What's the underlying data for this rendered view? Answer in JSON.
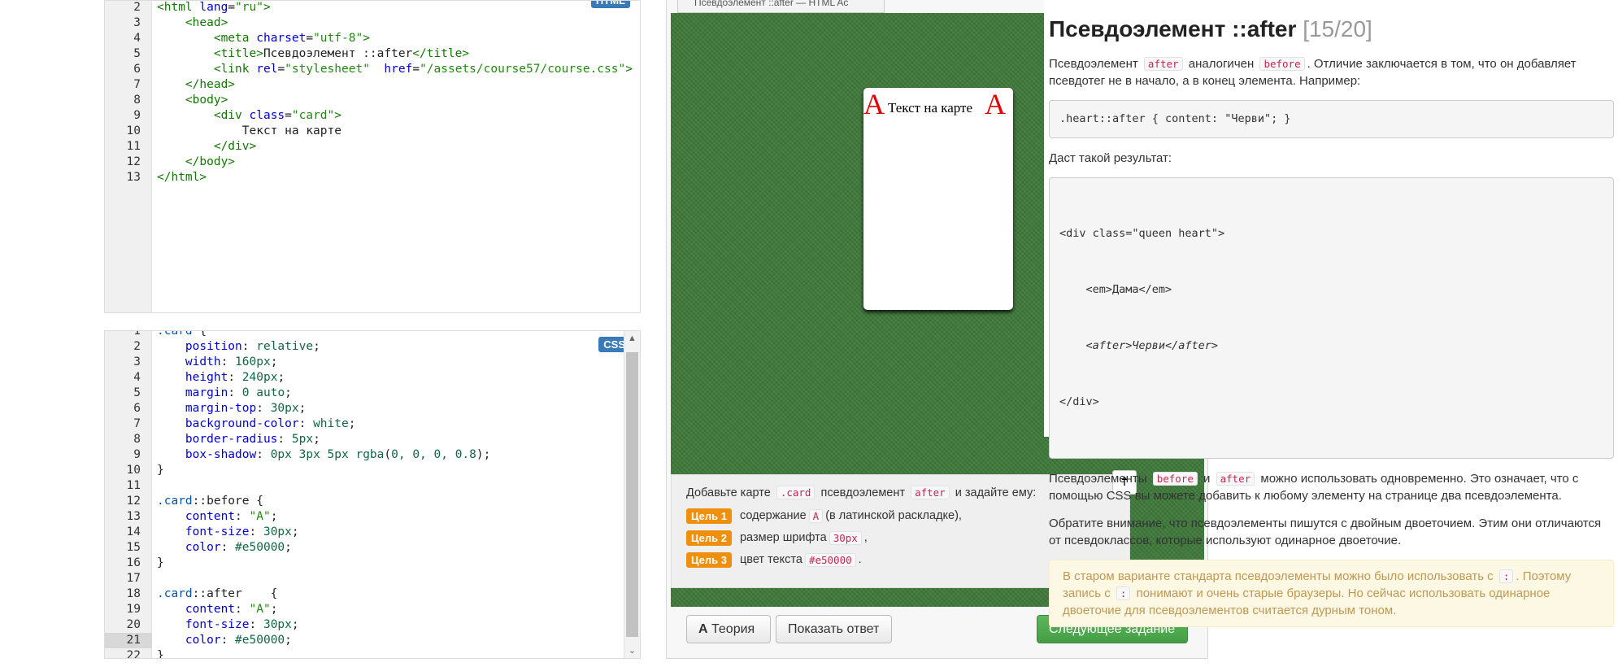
{
  "html_editor": {
    "badge": "HTML",
    "lines": [
      {
        "n": "2",
        "parts": [
          [
            "t-tag",
            "<html "
          ],
          [
            "t-attr",
            "lang"
          ],
          [
            "",
            "="
          ],
          [
            "t-str2",
            "\"ru\""
          ],
          [
            "t-tag",
            ">"
          ]
        ]
      },
      {
        "n": "3",
        "parts": [
          [
            "",
            "    "
          ],
          [
            "t-tag",
            "<head>"
          ]
        ]
      },
      {
        "n": "4",
        "parts": [
          [
            "",
            "        "
          ],
          [
            "t-tag",
            "<meta "
          ],
          [
            "t-attr",
            "charset"
          ],
          [
            "",
            "="
          ],
          [
            "t-str2",
            "\"utf-8\""
          ],
          [
            "t-tag",
            ">"
          ]
        ]
      },
      {
        "n": "5",
        "parts": [
          [
            "",
            "        "
          ],
          [
            "t-tag",
            "<title>"
          ],
          [
            "",
            "Псевдоэлемент ::after"
          ],
          [
            "t-tag",
            "</title>"
          ]
        ]
      },
      {
        "n": "6",
        "parts": [
          [
            "",
            "        "
          ],
          [
            "t-tag",
            "<link "
          ],
          [
            "t-attr",
            "rel"
          ],
          [
            "",
            "="
          ],
          [
            "t-str2",
            "\"stylesheet\""
          ],
          [
            "",
            "  "
          ],
          [
            "t-attr",
            "href"
          ],
          [
            "",
            "="
          ],
          [
            "t-str2",
            "\"/assets/course57/course.css\""
          ],
          [
            "t-tag",
            ">"
          ]
        ]
      },
      {
        "n": "7",
        "parts": [
          [
            "",
            "    "
          ],
          [
            "t-tag",
            "</head>"
          ]
        ]
      },
      {
        "n": "8",
        "parts": [
          [
            "",
            "    "
          ],
          [
            "t-tag",
            "<body>"
          ]
        ]
      },
      {
        "n": "9",
        "parts": [
          [
            "",
            "        "
          ],
          [
            "t-tag",
            "<div "
          ],
          [
            "t-attr",
            "class"
          ],
          [
            "",
            "="
          ],
          [
            "t-str2",
            "\"card\""
          ],
          [
            "t-tag",
            ">"
          ]
        ]
      },
      {
        "n": "10",
        "parts": [
          [
            "",
            "            Текст на карте"
          ]
        ]
      },
      {
        "n": "11",
        "parts": [
          [
            "",
            "        "
          ],
          [
            "t-tag",
            "</div>"
          ]
        ]
      },
      {
        "n": "12",
        "parts": [
          [
            "",
            "    "
          ],
          [
            "t-tag",
            "</body>"
          ]
        ]
      },
      {
        "n": "13",
        "parts": [
          [
            "t-tag",
            "</html>"
          ]
        ]
      }
    ]
  },
  "css_editor": {
    "badge": "CSS",
    "lines": [
      {
        "n": "1",
        "parts": [
          [
            "t-sel",
            ".card "
          ],
          [
            "",
            "{"
          ]
        ]
      },
      {
        "n": "2",
        "parts": [
          [
            "",
            "    "
          ],
          [
            "t-prop",
            "position"
          ],
          [
            "",
            ": "
          ],
          [
            "t-val",
            "relative"
          ],
          [
            "",
            ";"
          ]
        ]
      },
      {
        "n": "3",
        "parts": [
          [
            "",
            "    "
          ],
          [
            "t-prop",
            "width"
          ],
          [
            "",
            ": "
          ],
          [
            "t-num",
            "160px"
          ],
          [
            "",
            ";"
          ]
        ]
      },
      {
        "n": "4",
        "parts": [
          [
            "",
            "    "
          ],
          [
            "t-prop",
            "height"
          ],
          [
            "",
            ": "
          ],
          [
            "t-num",
            "240px"
          ],
          [
            "",
            ";"
          ]
        ]
      },
      {
        "n": "5",
        "parts": [
          [
            "",
            "    "
          ],
          [
            "t-prop",
            "margin"
          ],
          [
            "",
            ": "
          ],
          [
            "t-num",
            "0"
          ],
          [
            "",
            " "
          ],
          [
            "t-val",
            "auto"
          ],
          [
            "",
            ";"
          ]
        ]
      },
      {
        "n": "6",
        "parts": [
          [
            "",
            "    "
          ],
          [
            "t-prop",
            "margin-top"
          ],
          [
            "",
            ": "
          ],
          [
            "t-num",
            "30px"
          ],
          [
            "",
            ";"
          ]
        ]
      },
      {
        "n": "7",
        "parts": [
          [
            "",
            "    "
          ],
          [
            "t-prop",
            "background-color"
          ],
          [
            "",
            ": "
          ],
          [
            "t-val",
            "white"
          ],
          [
            "",
            ";"
          ]
        ]
      },
      {
        "n": "8",
        "parts": [
          [
            "",
            "    "
          ],
          [
            "t-prop",
            "border-radius"
          ],
          [
            "",
            ": "
          ],
          [
            "t-num",
            "5px"
          ],
          [
            "",
            ";"
          ]
        ]
      },
      {
        "n": "9",
        "parts": [
          [
            "",
            "    "
          ],
          [
            "t-prop",
            "box-shadow"
          ],
          [
            "",
            ": "
          ],
          [
            "t-num",
            "0px 3px 5px "
          ],
          [
            "t-val",
            "rgba"
          ],
          [
            "",
            "("
          ],
          [
            "t-num",
            "0, 0, 0, 0.8"
          ],
          [
            "",
            ");"
          ]
        ]
      },
      {
        "n": "10",
        "parts": [
          [
            "",
            "}"
          ]
        ]
      },
      {
        "n": "11",
        "parts": []
      },
      {
        "n": "12",
        "parts": [
          [
            "t-sel",
            ".card"
          ],
          [
            "",
            "::before {"
          ]
        ]
      },
      {
        "n": "13",
        "parts": [
          [
            "",
            "    "
          ],
          [
            "t-prop",
            "content"
          ],
          [
            "",
            ": "
          ],
          [
            "t-str2",
            "\"A\""
          ],
          [
            "",
            ";"
          ]
        ]
      },
      {
        "n": "14",
        "parts": [
          [
            "",
            "    "
          ],
          [
            "t-prop",
            "font-size"
          ],
          [
            "",
            ": "
          ],
          [
            "t-num",
            "30px"
          ],
          [
            "",
            ";"
          ]
        ]
      },
      {
        "n": "15",
        "parts": [
          [
            "",
            "    "
          ],
          [
            "t-prop",
            "color"
          ],
          [
            "",
            ": "
          ],
          [
            "t-num",
            "#e50000"
          ],
          [
            "",
            ";"
          ]
        ]
      },
      {
        "n": "16",
        "parts": [
          [
            "",
            "}"
          ]
        ]
      },
      {
        "n": "17",
        "parts": []
      },
      {
        "n": "18",
        "parts": [
          [
            "t-sel",
            ".card"
          ],
          [
            "",
            "::after    {"
          ]
        ]
      },
      {
        "n": "19",
        "parts": [
          [
            "",
            "    "
          ],
          [
            "t-prop",
            "content"
          ],
          [
            "",
            ": "
          ],
          [
            "t-str2",
            "\"A\""
          ],
          [
            "",
            ";"
          ]
        ]
      },
      {
        "n": "20",
        "parts": [
          [
            "",
            "    "
          ],
          [
            "t-prop",
            "font-size"
          ],
          [
            "",
            ": "
          ],
          [
            "t-num",
            "30px"
          ],
          [
            "",
            ";"
          ]
        ]
      },
      {
        "n": "21",
        "parts": [
          [
            "",
            "    "
          ],
          [
            "t-prop",
            "color"
          ],
          [
            "",
            ": "
          ],
          [
            "t-num",
            "#e50000"
          ],
          [
            "",
            ";"
          ]
        ],
        "active": true
      },
      {
        "n": "22",
        "parts": [
          [
            "",
            "}"
          ]
        ]
      }
    ]
  },
  "preview": {
    "tab_title": "Псевдоэлемент ::after — HTML Ac",
    "card_before": "A",
    "card_text": "Текст на карте",
    "card_after": "A"
  },
  "task": {
    "intro_1": "Добавьте карте",
    "intro_code_1": ".card",
    "intro_2": "псевдоэлемент",
    "intro_code_2": "after",
    "intro_3": "и задайте ему:",
    "goals": [
      {
        "label": "Цель 1",
        "text_1": "содержание",
        "code": "A",
        "text_2": "(в латинской раскладке),"
      },
      {
        "label": "Цель 2",
        "text_1": "размер шрифта",
        "code": "30px",
        "text_2": ","
      },
      {
        "label": "Цель 3",
        "text_1": "цвет текста",
        "code": "#e50000",
        "text_2": "."
      }
    ]
  },
  "buttons": {
    "theory": "Теория",
    "theory_icon": "A",
    "show_answer": "Показать ответ",
    "next": "Следующее задание",
    "up": "🠅"
  },
  "theory": {
    "title": "Псевдоэлемент ::after",
    "counter": "[15/20]",
    "p1_a": "Псевдоэлемент",
    "p1_c1": "after",
    "p1_b": "аналогичен",
    "p1_c2": "before",
    "p1_c": ". Отличие заключается в том, что он добавляет псевдотег не в начало, а в конец элемента. Например:",
    "code1": ".heart::after { content: \"Черви\"; }",
    "p2": "Даст такой результат:",
    "code2_l1": "<div class=\"queen heart\">",
    "code2_l2": "    <em>Дама</em>",
    "code2_l3": "    <after>Черви</after>",
    "code2_l4": "</div>",
    "p3_a": "Псевдоэлементы",
    "p3_c1": "before",
    "p3_b": "и",
    "p3_c2": "after",
    "p3_c": "можно использовать одновременно. Это означает, что с помощью CSS вы можете добавить к любому элементу на странице два псевдоэлемента.",
    "p4": "Обратите внимание, что псевдоэлементы пишутся с двойным двоеточием. Этим они отличаются от псевдоклассов, которые используют одинарное двоеточие.",
    "warn_a": "В старом варианте стандарта псевдоэлементы можно было использовать с",
    "warn_c1": ":",
    "warn_b": ". Поэтому запись с",
    "warn_c2": ":",
    "warn_c": "понимают и очень старые браузеры. Но сейчас использовать одинарное двоеточие для псевдоэлементов считается дурным тоном."
  }
}
